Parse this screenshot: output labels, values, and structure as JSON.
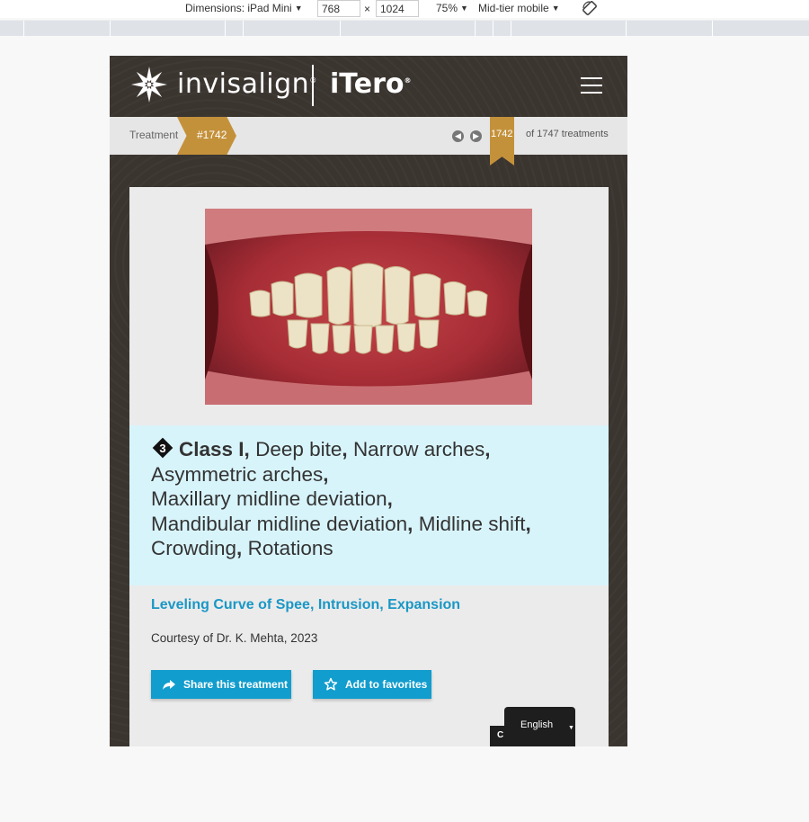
{
  "devtools": {
    "dimensions_label": "Dimensions: iPad Mini",
    "width": "768",
    "times": "×",
    "height": "1024",
    "zoom": "75%",
    "throttle": "Mid-tier mobile"
  },
  "header": {
    "brand": "invisalign",
    "brand_mark": "®",
    "brand2": "iTero",
    "brand2_mark": "®"
  },
  "breadcrumb": {
    "label": "Treatment",
    "tag": "#1742",
    "current": "1742",
    "count": "of 1747 treatments"
  },
  "case": {
    "number": "3",
    "class_bold": "Class I",
    "comma": ",",
    "conditions": [
      "Deep bite",
      "Narrow arches",
      "Asymmetric arches",
      "Maxillary midline deviation",
      "Mandibular midline deviation",
      "Midline shift",
      "Crowding",
      "Rotations"
    ],
    "treatments": "Leveling Curve of Spee, Intrusion, Expansion",
    "courtesy": "Courtesy of Dr. K. Mehta, 2023"
  },
  "actions": {
    "share": "Share this treatment",
    "favorite": "Add to favorites"
  },
  "language": {
    "current": "English",
    "cookie_tab": "C"
  },
  "colors": {
    "accent_gold": "#c4913b",
    "accent_blue": "#119dcd",
    "header_bg": "#3b3530",
    "classbox_bg": "#d8f4fb"
  }
}
